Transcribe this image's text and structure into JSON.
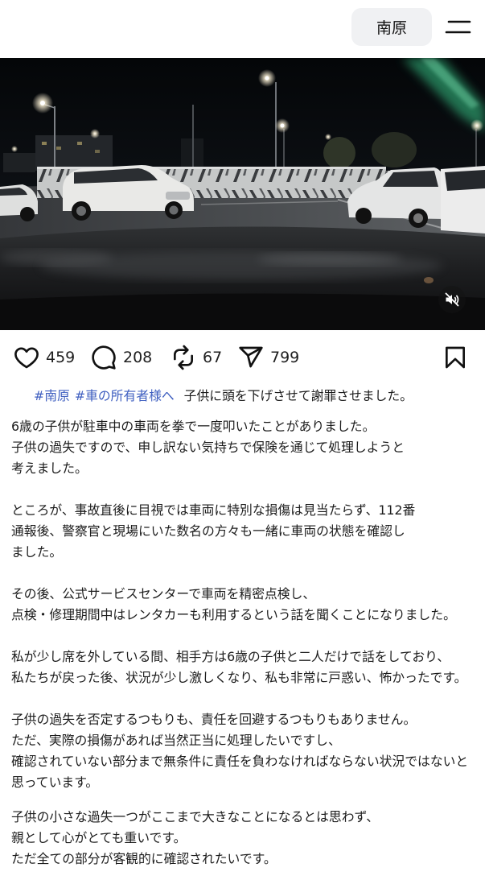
{
  "header": {
    "location_button": "南原",
    "menu_icon": "menu-icon"
  },
  "video": {
    "mute_icon": "speaker-muted-icon"
  },
  "actions": {
    "like": {
      "icon": "heart-icon",
      "count": "459"
    },
    "comment": {
      "icon": "comment-icon",
      "count": "208"
    },
    "repost": {
      "icon": "repost-icon",
      "count": "67"
    },
    "share": {
      "icon": "send-icon",
      "count": "799"
    },
    "save": {
      "icon": "bookmark-icon"
    }
  },
  "caption": {
    "hashtags": [
      "#南原",
      "#車の所有者様へ"
    ],
    "text": "子供に頭を下げさせて謝罪させました。"
  },
  "body": {
    "paragraphs": [
      [
        "6歳の子供が駐車中の車両を拳で一度叩いたことがありました。",
        "子供の過失ですので、申し訳ない気持ちで保険を通じて処理しようと",
        "考えました。"
      ],
      [
        "ところが、事故直後に目視では車両に特別な損傷は見当たらず、112番",
        "通報後、警察官と現場にいた数名の方々も一緒に車両の状態を確認し",
        "ました。"
      ],
      [
        "その後、公式サービスセンターで車両を精密点検し、",
        "点検・修理期間中はレンタカーも利用するという話を聞くことになりました。"
      ],
      [
        "私が少し席を外している間、相手方は6歳の子供と二人だけで話をしており、",
        "私たちが戻った後、状況が少し激しくなり、私も非常に戸惑い、怖かったです。"
      ],
      [
        "子供の過失を否定するつもりも、責任を回避するつもりもありません。",
        "ただ、実際の損傷があれば当然正当に処理したいですし、",
        "確認されていない部分まで無条件に責任を負わなければならない状況ではないと",
        "思っています。"
      ],
      [
        "子供の小さな過失一つがここまで大きなことになるとは思わず、",
        "親として心がとても重いです。",
        "ただ全ての部分が客観的に確認されたいです。"
      ]
    ]
  },
  "colors": {
    "hashtag": "#3f5fc0",
    "text": "#1c1c1c",
    "pill_background": "#f0f1f3",
    "video_background": "#0b0d10"
  }
}
